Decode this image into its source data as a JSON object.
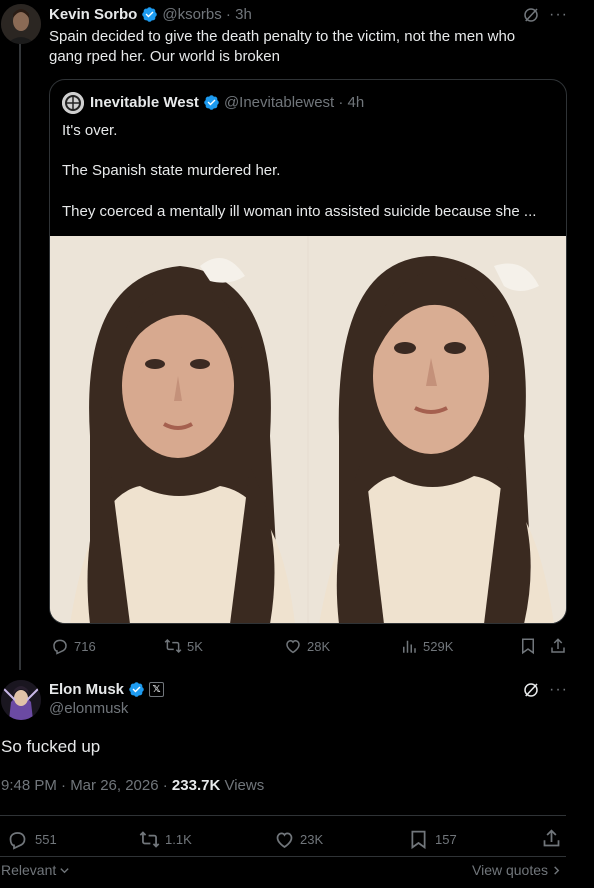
{
  "parent_tweet": {
    "author_name": "Kevin Sorbo",
    "handle_time": "@ksorbs · 3h",
    "text": "Spain decided to give the death penalty to the victim, not the men who gang rped her. Our world is broken",
    "quote": {
      "author_name": "Inevitable West",
      "handle_time": "@Inevitablewest · 4h",
      "line1": "It's over.",
      "line2": "The Spanish state murdered her.",
      "line3": "They coerced a mentally ill woman into assisted suicide because she ..."
    },
    "stats": {
      "replies": "716",
      "reposts": "5K",
      "likes": "28K",
      "views": "529K"
    }
  },
  "main_tweet": {
    "author_name": "Elon Musk",
    "handle": "@elonmusk",
    "text": "So fucked up",
    "timestamp": "9:48 PM · Mar 26, 2026 · ",
    "views_count": "233.7K",
    "views_label": " Views",
    "stats": {
      "replies": "551",
      "reposts": "1.1K",
      "likes": "23K",
      "bookmarks": "157"
    }
  },
  "footer": {
    "sort_label": "Relevant",
    "view_quotes_label": "View quotes"
  },
  "colors": {
    "background": "#000000",
    "text": "#e7e9ea",
    "muted": "#71767b",
    "verified_blue": "#1d9bf0",
    "divider": "#2f3336"
  }
}
